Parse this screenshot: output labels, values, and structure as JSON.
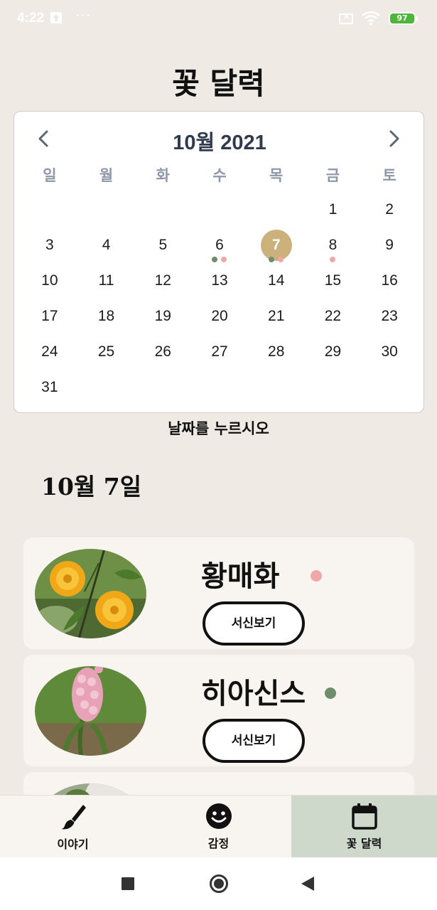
{
  "status_bar": {
    "time": "4:22",
    "dots": "···",
    "battery": "97"
  },
  "app_title": "꽃 달력",
  "calendar": {
    "month_label": "10월 2021",
    "weekdays": [
      "일",
      "월",
      "화",
      "수",
      "목",
      "금",
      "토"
    ],
    "leading_blanks": 5,
    "days": [
      "1",
      "2",
      "3",
      "4",
      "5",
      "6",
      "7",
      "8",
      "9",
      "10",
      "11",
      "12",
      "13",
      "14",
      "15",
      "16",
      "17",
      "18",
      "19",
      "20",
      "21",
      "22",
      "23",
      "24",
      "25",
      "26",
      "27",
      "28",
      "29",
      "30",
      "31"
    ],
    "selected_day": "7",
    "marked_days": {
      "6": [
        "green",
        "pink"
      ],
      "7": [
        "green",
        "pink"
      ],
      "8": [
        "pink"
      ]
    }
  },
  "hint": "날짜를 누르시오",
  "selected_date_heading": "10월 7일",
  "flowers": [
    {
      "name": "황매화",
      "color": "#f1a7a8",
      "button": "서신보기",
      "image": "yellow-kerria-flower"
    },
    {
      "name": "히아신스",
      "color": "#6f8c6b",
      "button": "서신보기",
      "image": "pink-hyacinth-flower"
    },
    {
      "name": "",
      "color": "",
      "button": "",
      "image": "partial-flower"
    }
  ],
  "bottom_nav": [
    {
      "label": "이야기",
      "icon": "brush-icon",
      "active": false
    },
    {
      "label": "감정",
      "icon": "smiley-icon",
      "active": false
    },
    {
      "label": "꽃 달력",
      "icon": "calendar-icon",
      "active": true
    }
  ],
  "colors": {
    "background": "#efebe4",
    "selected_day": "#cdb17d",
    "dot_green": "#6f8c6b",
    "dot_pink": "#f1a7a8",
    "nav_active": "#cfd9cb"
  }
}
